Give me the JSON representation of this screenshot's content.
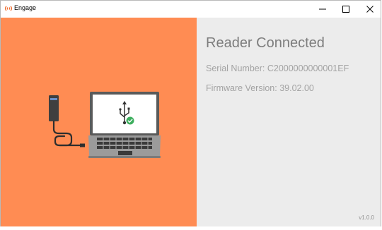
{
  "window": {
    "title": "Engage",
    "app_icon": "engage-logo-icon",
    "controls": [
      "minimize-icon",
      "maximize-icon",
      "close-icon"
    ]
  },
  "status": {
    "title": "Reader Connected",
    "serial_number": "Serial Number: C2000000000001EF",
    "firmware_version": "Firmware Version: 39.02.00",
    "app_version": "v1.0.0"
  },
  "illustration": {
    "laptop_icon": "usb-icon",
    "check_icon": "check-circle-icon"
  },
  "colors": {
    "left_panel": "#ff8c53",
    "right_panel": "#ececec",
    "check": "#3dae5e"
  }
}
